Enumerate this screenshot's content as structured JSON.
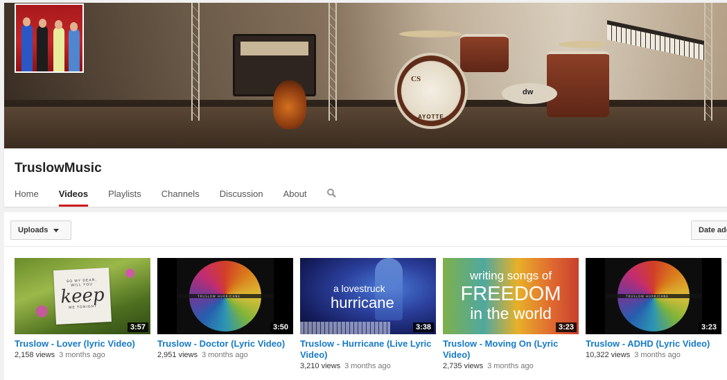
{
  "channel": {
    "name": "TruslowMusic"
  },
  "tabs": [
    {
      "label": "Home"
    },
    {
      "label": "Videos",
      "active": true
    },
    {
      "label": "Playlists"
    },
    {
      "label": "Channels"
    },
    {
      "label": "Discussion"
    },
    {
      "label": "About"
    }
  ],
  "toolbar": {
    "uploads_label": "Uploads",
    "sort_label": "Date added"
  },
  "videos": [
    {
      "title": "Truslow - Lover (lyric Video)",
      "views": "2,158 views",
      "ago": "3 months ago",
      "duration": "3:57",
      "thumb_text": [
        "SO MY DEAR,",
        "WILL YOU",
        "keep",
        "ME TONIGHT"
      ]
    },
    {
      "title": "Truslow - Doctor (Lyric Video)",
      "views": "2,951 views",
      "ago": "3 months ago",
      "duration": "3:50",
      "thumb_text": "TRUSLOW HURRICANE"
    },
    {
      "title": "Truslow - Hurricane (Live Lyric Video)",
      "views": "3,210 views",
      "ago": "3 months ago",
      "duration": "3:38",
      "thumb_text": [
        "a lovestruck",
        "hurricane"
      ]
    },
    {
      "title": "Truslow - Moving On (Lyric Video)",
      "views": "2,735 views",
      "ago": "3 months ago",
      "duration": "3:23",
      "thumb_text": [
        "writing songs of",
        "FREEDOM",
        "in the world"
      ]
    },
    {
      "title": "Truslow - ADHD (Lyric Video)",
      "views": "10,322 views",
      "ago": "3 months ago",
      "duration": "3:23",
      "thumb_text": "TRUSLOW HURRICANE"
    }
  ],
  "banner": {
    "drum_text": "AYOTTE",
    "drum_logo": "CS",
    "tom_text": "dw"
  },
  "colors": {
    "accent": "#cc181e",
    "link": "#167ac6"
  },
  "icons": {
    "search": "search-icon",
    "caret": "caret-down-icon"
  }
}
